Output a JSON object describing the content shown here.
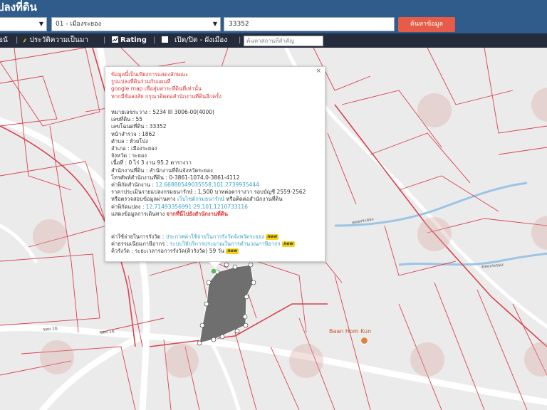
{
  "header": {
    "title": "ปลงที่ดิน"
  },
  "search": {
    "province_value": "",
    "amphoe_value": "01 - เมืองระยอง",
    "parcel_value": "33352",
    "search_button": "ค้นหาข้อมูล"
  },
  "toolbar": {
    "item1": "อนั",
    "item2": "ประวัติความเป็นมา",
    "item3": "Rating",
    "item4": "เปิด/ปิด - ผังเมือง",
    "separator": "|",
    "search_placeholder": "ค้นหาสถานที่สำคัญ"
  },
  "popup": {
    "close": "×",
    "notice": [
      "ข้อมูลนี้เป็นเพียงการแสดงลักษณะ",
      "รูปแปลงที่ดินร่วมกับแผนที่",
      "google map เพื่อสุ่มสาระที่ดินที่เท่านั้น",
      "หากมีข้อสงสัย กรุณาติดต่อสำนักงานที่ดินอีกครั้ง"
    ],
    "utm_label": "หมายเลขระวาง",
    "utm_value": "5234 III 3006-00(4000)",
    "land_no_label": "เลขที่ดิน",
    "land_no_value": "55",
    "deed_label": "เลขโฉนดที่ดิน",
    "deed_value": "33352",
    "survey_label": "หน้าสำรวจ",
    "survey_value": "1862",
    "tambon_label": "ตำบล",
    "tambon_value": "ห้วยโป่ง",
    "amphoe_label": "อำเภอ",
    "amphoe_value": "เมืองระยอง",
    "province_label": "จังหวัด",
    "province_value": "ระยอง",
    "area_label": "เนื้อที่",
    "area_value": "0 ไร่ 3 งาน 95.2 ตารางวา",
    "office_label": "สำนักงานที่ดิน",
    "office_value": "สำนักงานที่ดินจังหวัดระยอง",
    "phone_label": "โทรศัพท์สำนักงานที่ดิน",
    "phone_value": "0-3861-1074,0-3861-4112",
    "office_coord_label": "ค่าพิกัดสำนักงาน",
    "office_coord_value": "12.66880549035558,101.2739935444",
    "price_label": "ราคาประเมินรายแปลงกรมธนารักษ์",
    "price_value": "1,500 บาทต่อตารางวา รอบบัญชี 2559-2562",
    "check_label": "หรือตรวจสอบข้อมูลผ่านทาง",
    "check_link": "เว็บไซต์กรมธนารักษ์",
    "check_suffix": "หรือติดต่อสำนักงานที่ดิน",
    "parcel_coord_label": "ค่าพิกัดแปลง",
    "parcel_coord_value": "12.71493356991 29,101.1210733116",
    "route_label": "แสดงข้อมูลการเดินทาง",
    "route_link": "จากที่นี่ไปยังสำนักงานที่ดิน",
    "queue_label": "ค่าใช้จ่ายในการรังวัด",
    "queue_link": "ประกาศค่าใช้จ่ายในการรังวัดจังหวัดระยอง",
    "service_label": "ค่าธรรมเนียมภาษีอากร",
    "service_link": "ระบบให้บริการประมาณในการคำนวณภาษีอากร",
    "wait_label": "คิวรังวัด",
    "wait_value": "ระยะเวลารอการรังวัด(คิวรังวัด) 59 วัน",
    "new_badge": "new"
  },
  "map": {
    "poi_name": "Baan Hom Kun",
    "road1": "คลองระยอง",
    "road2": "คลองระยอง",
    "road3": "ซอย 16",
    "road4": "ซอย 16"
  }
}
